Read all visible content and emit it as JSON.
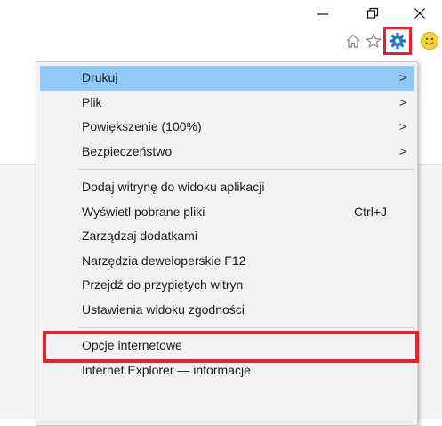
{
  "window": {
    "minimize_glyph": "—",
    "restore_glyph": "❐",
    "close_glyph": "✕"
  },
  "toolbar": {
    "icons": [
      "home-icon",
      "star-icon",
      "gear-icon",
      "smiley-icon"
    ],
    "highlight_color": "#e3222d"
  },
  "menu": {
    "highlight_color": "#90c8f6",
    "groups": [
      {
        "items": [
          {
            "label": "Drukuj",
            "arrow": ">"
          },
          {
            "label": "Plik",
            "arrow": ">"
          },
          {
            "label": "Powiększenie (100%)",
            "arrow": ">"
          },
          {
            "label": "Bezpieczeństwo",
            "arrow": ">"
          }
        ]
      },
      {
        "items": [
          {
            "label": "Dodaj witrynę do widoku aplikacji"
          },
          {
            "label": "Wyświetl pobrane pliki",
            "shortcut": "Ctrl+J"
          },
          {
            "label": "Zarządzaj dodatkami"
          },
          {
            "label": "Narzędzia deweloperskie F12"
          },
          {
            "label": "Przejdź do przypiętych witryn"
          },
          {
            "label": "Ustawienia widoku zgodności"
          }
        ]
      },
      {
        "items": [
          {
            "label": "Opcje internetowe"
          },
          {
            "label": "Internet Explorer — informacje"
          }
        ]
      }
    ]
  }
}
